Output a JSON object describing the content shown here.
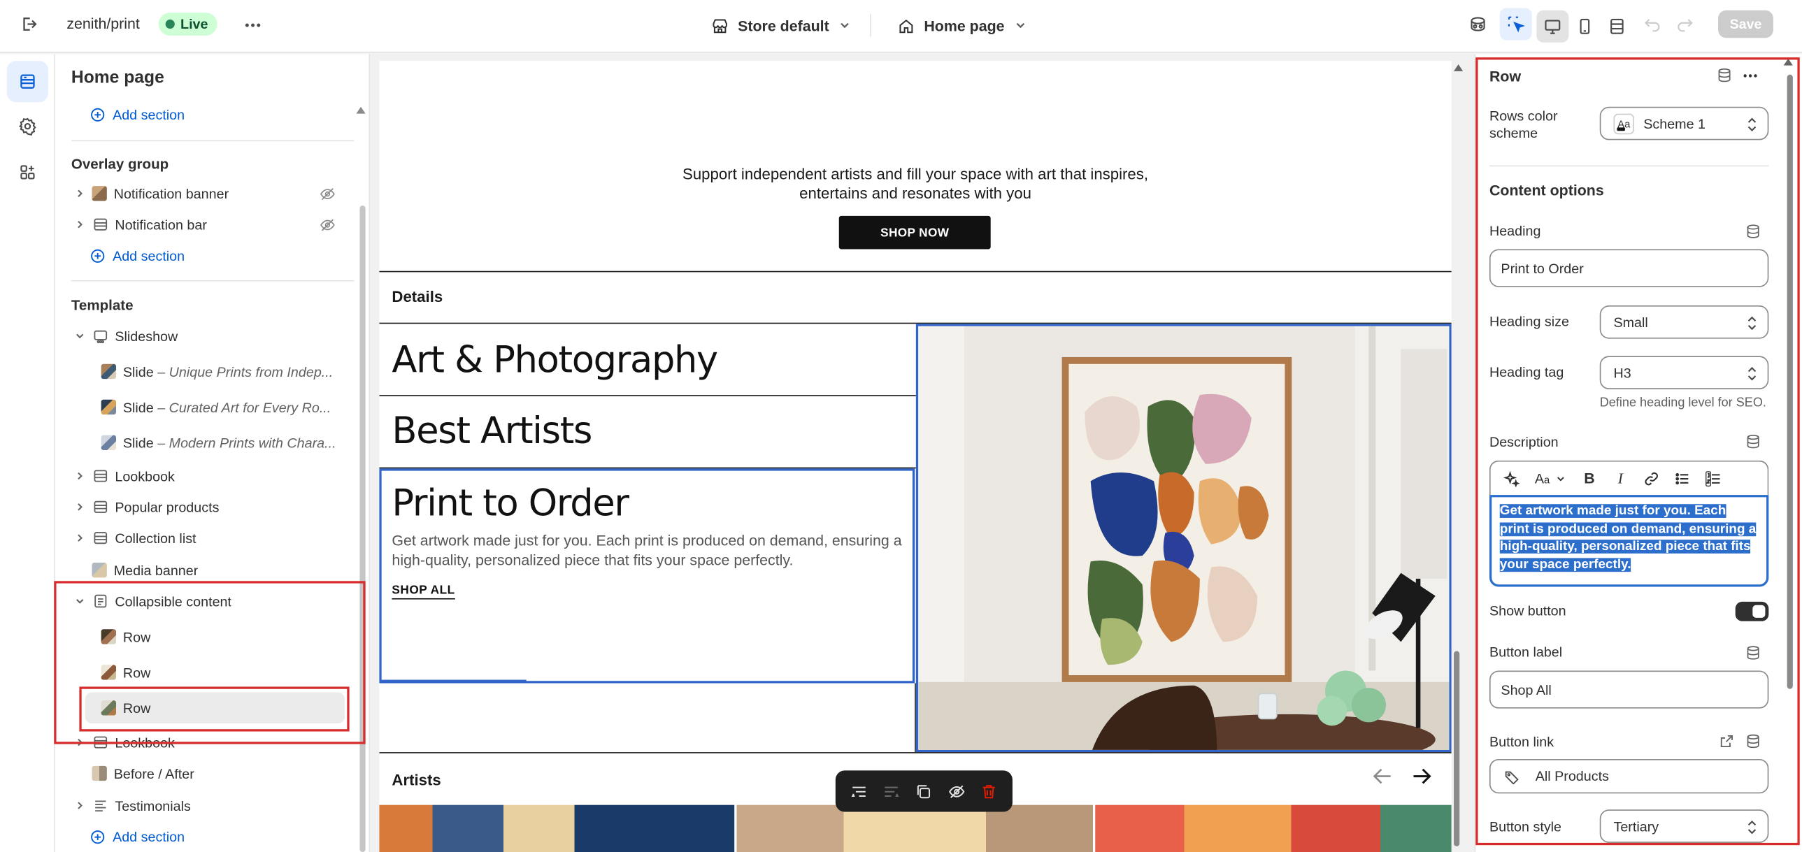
{
  "topbar": {
    "store_name": "zenith/print",
    "status": "Live",
    "theme_selector": "Store default",
    "page_selector": "Home page",
    "save_label": "Save",
    "icons": [
      "exit-icon",
      "more-icon",
      "store-icon",
      "home-icon",
      "chevron-down-icon",
      "inspector-icon",
      "select-icon",
      "desktop-icon",
      "mobile-icon",
      "full-width-icon",
      "undo-icon",
      "redo-icon"
    ]
  },
  "rail": {
    "items": [
      "sections-icon",
      "settings-icon",
      "apps-icon"
    ]
  },
  "sidebar": {
    "title": "Home page",
    "add_section_label": "Add section",
    "overlay_group": {
      "title": "Overlay group",
      "items": [
        {
          "label": "Notification banner",
          "hidden": true
        },
        {
          "label": "Notification bar",
          "hidden": true
        }
      ]
    },
    "template": {
      "title": "Template",
      "slideshow": "Slideshow",
      "slides": [
        {
          "label": "Slide",
          "sub": " – Unique Prints from Indep..."
        },
        {
          "label": "Slide",
          "sub": " – Curated Art for Every Ro..."
        },
        {
          "label": "Slide",
          "sub": " – Modern Prints with Chara..."
        }
      ],
      "sections": [
        "Lookbook",
        "Popular products",
        "Collection list",
        "Media banner"
      ],
      "collapsible": "Collapsible content",
      "rows": [
        "Row",
        "Row",
        "Row"
      ],
      "after": [
        "Lookbook",
        "Before / After",
        "Testimonials"
      ]
    }
  },
  "preview": {
    "hero_text_line1": "Support independent artists and fill your space with art that inspires,",
    "hero_text_line2": "entertains and resonates with you",
    "shop_now": "SHOP NOW",
    "details_label": "Details",
    "rows": [
      {
        "heading": "Art & Photography"
      },
      {
        "heading": "Best Artists"
      },
      {
        "heading": "Print to Order",
        "description": "Get artwork made just for you. Each print is produced on demand, ensuring a high-quality, personalized piece that fits your space perfectly.",
        "link": "SHOP ALL"
      }
    ],
    "artists_label": "Artists"
  },
  "floating_toolbar": {
    "icons": [
      "move-up-icon",
      "move-down-icon",
      "duplicate-icon",
      "hide-icon",
      "delete-icon"
    ]
  },
  "panel": {
    "title": "Row",
    "color_scheme_label": "Rows color scheme",
    "color_scheme_value": "Scheme 1",
    "color_scheme_swatch": "Aa",
    "content_options_title": "Content options",
    "heading_label": "Heading",
    "heading_value": "Print to Order",
    "heading_size_label": "Heading size",
    "heading_size_value": "Small",
    "heading_tag_label": "Heading tag",
    "heading_tag_value": "H3",
    "heading_tag_hint": "Define heading level for SEO.",
    "description_label": "Description",
    "description_value": "Get artwork made just for you. Each print is produced on demand, ensuring a high-quality, personalized piece that fits your space perfectly.",
    "show_button_label": "Show button",
    "show_button_on": true,
    "button_label_label": "Button label",
    "button_label_value": "Shop All",
    "button_link_label": "Button link",
    "button_link_value": "All Products",
    "button_style_label": "Button style",
    "button_style_value": "Tertiary"
  },
  "colors": {
    "accent": "#005bd3",
    "annotation": "#d72c2c",
    "live_badge_bg": "#cdfed4",
    "selection_blue": "#2c6ecb"
  }
}
